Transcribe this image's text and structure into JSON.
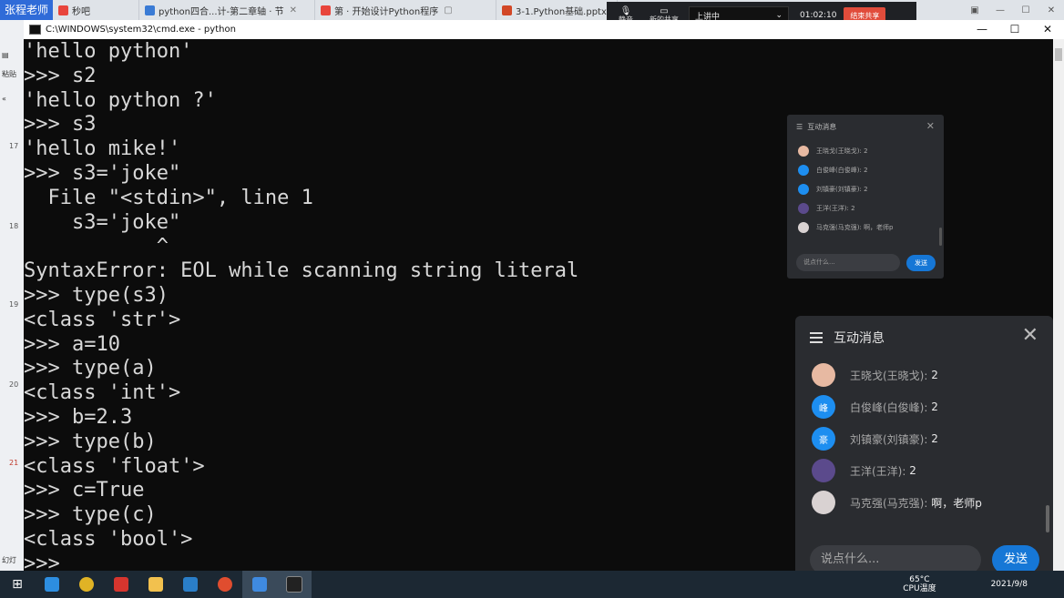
{
  "browser": {
    "user_tab": "张程老师",
    "tabs": [
      {
        "label": "秒吧",
        "color": "#e8453c"
      },
      {
        "label": "python四合...计-第二章轴 · 节",
        "color": "#3a7bd5"
      },
      {
        "label": "第 · 开始设计Python程序",
        "color": "#e8453c"
      },
      {
        "label": "3-1.Python基础.pptx",
        "color": "#d24726"
      }
    ]
  },
  "meeting": {
    "mic_label": "静音",
    "share_label": "新的共享",
    "audio_select": "上讲中",
    "timer": "01:02:10",
    "end_label": "结束共享"
  },
  "cmd": {
    "title": "C:\\WINDOWS\\system32\\cmd.exe - python",
    "lines": [
      "'hello python'",
      ">>> s2",
      "'hello python ?'",
      ">>> s3",
      "'hello mike!'",
      ">>> s3='joke\"",
      "  File \"<stdin>\", line 1",
      "    s3='joke\"",
      "           ^",
      "SyntaxError: EOL while scanning string literal",
      ">>> type(s3)",
      "<class 'str'>",
      ">>> a=10",
      ">>> type(a)",
      "<class 'int'>",
      ">>> b=2.3",
      ">>> type(b)",
      "<class 'float'>",
      ">>> c=True",
      ">>> type(c)",
      "<class 'bool'>",
      ">>>"
    ]
  },
  "left_strip": {
    "side_labels": [
      "粘贴",
      "幻灯"
    ],
    "numbers": [
      "17",
      "18",
      "19",
      "20",
      "21"
    ]
  },
  "chat": {
    "title": "互动消息",
    "messages": [
      {
        "name": "王晓戈(王晓戈):",
        "text": "2",
        "avatar_color": "#e7b9a2",
        "avatar_text": ""
      },
      {
        "name": "白俊峰(白俊峰):",
        "text": "2",
        "avatar_color": "#1d8ef0",
        "avatar_text": "峰"
      },
      {
        "name": "刘镇豪(刘镇豪):",
        "text": "2",
        "avatar_color": "#1d8ef0",
        "avatar_text": "豪"
      },
      {
        "name": "王洋(王洋):",
        "text": "2",
        "avatar_color": "#5b4a8c",
        "avatar_text": ""
      },
      {
        "name": "马克强(马克强):",
        "text": "啊，老师p",
        "avatar_color": "#d9d2d2",
        "avatar_text": ""
      }
    ],
    "placeholder": "说点什么...",
    "send_label": "发送"
  },
  "mini_chat": {
    "title": "互动消息",
    "placeholder": "说点什么...",
    "send_label": "发送"
  },
  "taskbar": {
    "apps": [
      {
        "name": "ie",
        "color": "#2d8ee0"
      },
      {
        "name": "chrome",
        "color": "#e0b325"
      },
      {
        "name": "wps",
        "color": "#d6352e"
      },
      {
        "name": "explorer",
        "color": "#f2c14e"
      },
      {
        "name": "vscode",
        "color": "#2a7ec8"
      },
      {
        "name": "record",
        "color": "#e04d2f"
      },
      {
        "name": "feishu",
        "color": "#3f8ae0"
      },
      {
        "name": "cmd",
        "color": "#222222"
      }
    ],
    "temperature": "65°C",
    "cpu_label": "CPU温度",
    "date": "2021/9/8"
  }
}
